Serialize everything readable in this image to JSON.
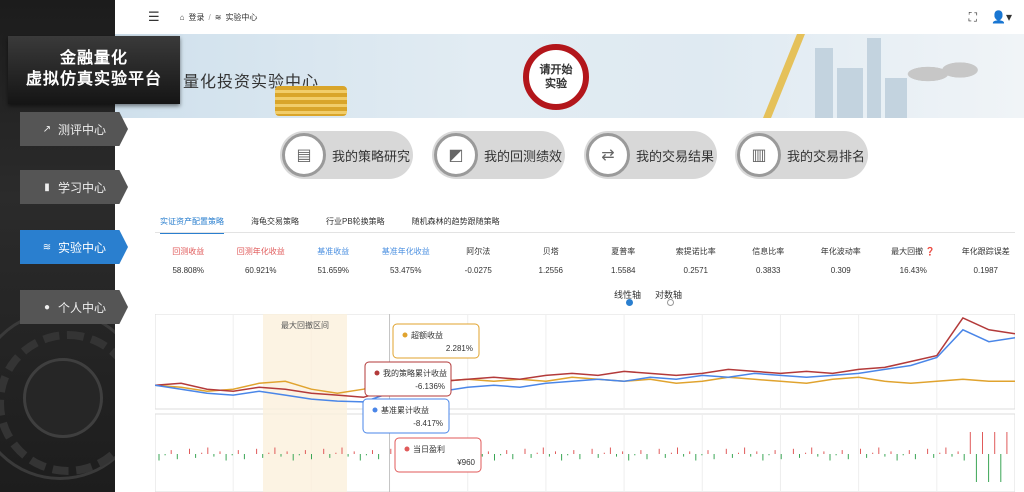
{
  "brand": {
    "line1": "金融量化",
    "line2": "虚拟仿真实验平台"
  },
  "sidebar": {
    "items": [
      {
        "label": "测评中心",
        "icon": "chart-line-icon"
      },
      {
        "label": "学习中心",
        "icon": "book-icon"
      },
      {
        "label": "实验中心",
        "icon": "layers-icon",
        "active": true
      },
      {
        "label": "个人中心",
        "icon": "user-icon"
      }
    ]
  },
  "topbar": {
    "breadcrumb": [
      "登录",
      "实验中心"
    ]
  },
  "hero": {
    "title": "量化投资实验中心",
    "start_line1": "请开始",
    "start_line2": "实验"
  },
  "actions": [
    "我的策略研究",
    "我的回测绩效",
    "我的交易结果",
    "我的交易排名"
  ],
  "tabs": [
    "实证资产配置策略",
    "海龟交易策略",
    "行业PB轮换策略",
    "随机森林的趋势跟随策略"
  ],
  "metrics": [
    {
      "name": "回测收益",
      "value": "58.808%",
      "color": "#e05a5a"
    },
    {
      "name": "回测年化收益",
      "value": "60.921%",
      "color": "#e05a5a"
    },
    {
      "name": "基准收益",
      "value": "51.659%",
      "color": "#4a8fe0"
    },
    {
      "name": "基准年化收益",
      "value": "53.475%",
      "color": "#4a8fe0"
    },
    {
      "name": "阿尔法",
      "value": "-0.0275"
    },
    {
      "name": "贝塔",
      "value": "1.2556"
    },
    {
      "name": "夏普率",
      "value": "1.5584"
    },
    {
      "name": "索提诺比率",
      "value": "0.2571"
    },
    {
      "name": "信息比率",
      "value": "0.3833"
    },
    {
      "name": "年化波动率",
      "value": "0.309"
    },
    {
      "name": "最大回撤",
      "value": "16.43%"
    },
    {
      "name": "年化跟踪误差",
      "value": "0.1987"
    }
  ],
  "axis_options": [
    "线性轴",
    "对数轴"
  ],
  "chart_data": {
    "type": "line",
    "annotation": "最大回撤区间",
    "series": [
      {
        "name": "超额收益",
        "color": "#e0a32e",
        "values": [
          0,
          -1,
          -3,
          -2,
          1,
          2,
          -2,
          -4,
          -2,
          2.3,
          1,
          2,
          3,
          2,
          3,
          2,
          4,
          3,
          2,
          3,
          1,
          2,
          4,
          3,
          2,
          1,
          3,
          4,
          2,
          1,
          2,
          3,
          2,
          2
        ]
      },
      {
        "name": "我的策略累计收益",
        "color": "#b33a3a",
        "values": [
          0,
          1,
          -2,
          -3,
          -1,
          -2,
          -4,
          -5,
          -6.1,
          -2,
          1,
          2,
          3,
          4,
          3,
          5,
          6,
          5,
          7,
          6,
          5,
          6,
          8,
          7,
          6,
          7,
          6,
          8,
          9,
          12,
          15,
          34,
          28,
          26
        ]
      },
      {
        "name": "基准累计收益",
        "color": "#4a86e8",
        "values": [
          0,
          -2,
          -4,
          -5,
          -3,
          -5,
          -7,
          -8,
          -8.4,
          -4,
          -2,
          -3,
          -1,
          0,
          -1,
          1,
          2,
          3,
          2,
          4,
          3,
          5,
          4,
          6,
          5,
          4,
          5,
          6,
          8,
          10,
          14,
          28,
          22,
          24
        ]
      }
    ],
    "tooltips": [
      {
        "name": "超额收益",
        "value": "2.281%",
        "color": "#e0a32e"
      },
      {
        "name": "我的策略累计收益",
        "value": "-6.136%",
        "color": "#b33a3a"
      },
      {
        "name": "基准累计收益",
        "value": "-8.417%",
        "color": "#4a86e8"
      },
      {
        "name": "当日盈利",
        "value": "¥960",
        "color": "#e05a5a"
      }
    ]
  }
}
